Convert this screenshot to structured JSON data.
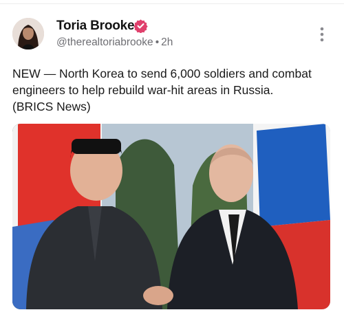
{
  "post": {
    "author": {
      "name": "Toria Brooke",
      "handle": "@therealtoriabrooke",
      "verified": true
    },
    "separator": "•",
    "time": "2h",
    "text": "NEW — North Korea to send 6,000 soldiers and combat engineers to help rebuild war-hit areas in Russia. (BRICS News)",
    "icons": {
      "verified": "verified-badge-icon",
      "more": "more-options-icon"
    },
    "colors": {
      "verified_badge": "#e0406c",
      "name_text": "#141414",
      "meta_text": "#6e6e73"
    }
  }
}
